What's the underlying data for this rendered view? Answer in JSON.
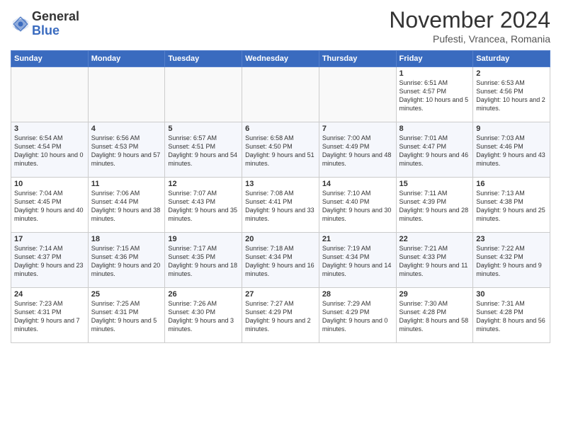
{
  "header": {
    "logo_general": "General",
    "logo_blue": "Blue",
    "month_title": "November 2024",
    "location": "Pufesti, Vrancea, Romania"
  },
  "days_of_week": [
    "Sunday",
    "Monday",
    "Tuesday",
    "Wednesday",
    "Thursday",
    "Friday",
    "Saturday"
  ],
  "weeks": [
    [
      {
        "day": "",
        "info": ""
      },
      {
        "day": "",
        "info": ""
      },
      {
        "day": "",
        "info": ""
      },
      {
        "day": "",
        "info": ""
      },
      {
        "day": "",
        "info": ""
      },
      {
        "day": "1",
        "info": "Sunrise: 6:51 AM\nSunset: 4:57 PM\nDaylight: 10 hours and 5 minutes."
      },
      {
        "day": "2",
        "info": "Sunrise: 6:53 AM\nSunset: 4:56 PM\nDaylight: 10 hours and 2 minutes."
      }
    ],
    [
      {
        "day": "3",
        "info": "Sunrise: 6:54 AM\nSunset: 4:54 PM\nDaylight: 10 hours and 0 minutes."
      },
      {
        "day": "4",
        "info": "Sunrise: 6:56 AM\nSunset: 4:53 PM\nDaylight: 9 hours and 57 minutes."
      },
      {
        "day": "5",
        "info": "Sunrise: 6:57 AM\nSunset: 4:51 PM\nDaylight: 9 hours and 54 minutes."
      },
      {
        "day": "6",
        "info": "Sunrise: 6:58 AM\nSunset: 4:50 PM\nDaylight: 9 hours and 51 minutes."
      },
      {
        "day": "7",
        "info": "Sunrise: 7:00 AM\nSunset: 4:49 PM\nDaylight: 9 hours and 48 minutes."
      },
      {
        "day": "8",
        "info": "Sunrise: 7:01 AM\nSunset: 4:47 PM\nDaylight: 9 hours and 46 minutes."
      },
      {
        "day": "9",
        "info": "Sunrise: 7:03 AM\nSunset: 4:46 PM\nDaylight: 9 hours and 43 minutes."
      }
    ],
    [
      {
        "day": "10",
        "info": "Sunrise: 7:04 AM\nSunset: 4:45 PM\nDaylight: 9 hours and 40 minutes."
      },
      {
        "day": "11",
        "info": "Sunrise: 7:06 AM\nSunset: 4:44 PM\nDaylight: 9 hours and 38 minutes."
      },
      {
        "day": "12",
        "info": "Sunrise: 7:07 AM\nSunset: 4:43 PM\nDaylight: 9 hours and 35 minutes."
      },
      {
        "day": "13",
        "info": "Sunrise: 7:08 AM\nSunset: 4:41 PM\nDaylight: 9 hours and 33 minutes."
      },
      {
        "day": "14",
        "info": "Sunrise: 7:10 AM\nSunset: 4:40 PM\nDaylight: 9 hours and 30 minutes."
      },
      {
        "day": "15",
        "info": "Sunrise: 7:11 AM\nSunset: 4:39 PM\nDaylight: 9 hours and 28 minutes."
      },
      {
        "day": "16",
        "info": "Sunrise: 7:13 AM\nSunset: 4:38 PM\nDaylight: 9 hours and 25 minutes."
      }
    ],
    [
      {
        "day": "17",
        "info": "Sunrise: 7:14 AM\nSunset: 4:37 PM\nDaylight: 9 hours and 23 minutes."
      },
      {
        "day": "18",
        "info": "Sunrise: 7:15 AM\nSunset: 4:36 PM\nDaylight: 9 hours and 20 minutes."
      },
      {
        "day": "19",
        "info": "Sunrise: 7:17 AM\nSunset: 4:35 PM\nDaylight: 9 hours and 18 minutes."
      },
      {
        "day": "20",
        "info": "Sunrise: 7:18 AM\nSunset: 4:34 PM\nDaylight: 9 hours and 16 minutes."
      },
      {
        "day": "21",
        "info": "Sunrise: 7:19 AM\nSunset: 4:34 PM\nDaylight: 9 hours and 14 minutes."
      },
      {
        "day": "22",
        "info": "Sunrise: 7:21 AM\nSunset: 4:33 PM\nDaylight: 9 hours and 11 minutes."
      },
      {
        "day": "23",
        "info": "Sunrise: 7:22 AM\nSunset: 4:32 PM\nDaylight: 9 hours and 9 minutes."
      }
    ],
    [
      {
        "day": "24",
        "info": "Sunrise: 7:23 AM\nSunset: 4:31 PM\nDaylight: 9 hours and 7 minutes."
      },
      {
        "day": "25",
        "info": "Sunrise: 7:25 AM\nSunset: 4:31 PM\nDaylight: 9 hours and 5 minutes."
      },
      {
        "day": "26",
        "info": "Sunrise: 7:26 AM\nSunset: 4:30 PM\nDaylight: 9 hours and 3 minutes."
      },
      {
        "day": "27",
        "info": "Sunrise: 7:27 AM\nSunset: 4:29 PM\nDaylight: 9 hours and 2 minutes."
      },
      {
        "day": "28",
        "info": "Sunrise: 7:29 AM\nSunset: 4:29 PM\nDaylight: 9 hours and 0 minutes."
      },
      {
        "day": "29",
        "info": "Sunrise: 7:30 AM\nSunset: 4:28 PM\nDaylight: 8 hours and 58 minutes."
      },
      {
        "day": "30",
        "info": "Sunrise: 7:31 AM\nSunset: 4:28 PM\nDaylight: 8 hours and 56 minutes."
      }
    ]
  ]
}
